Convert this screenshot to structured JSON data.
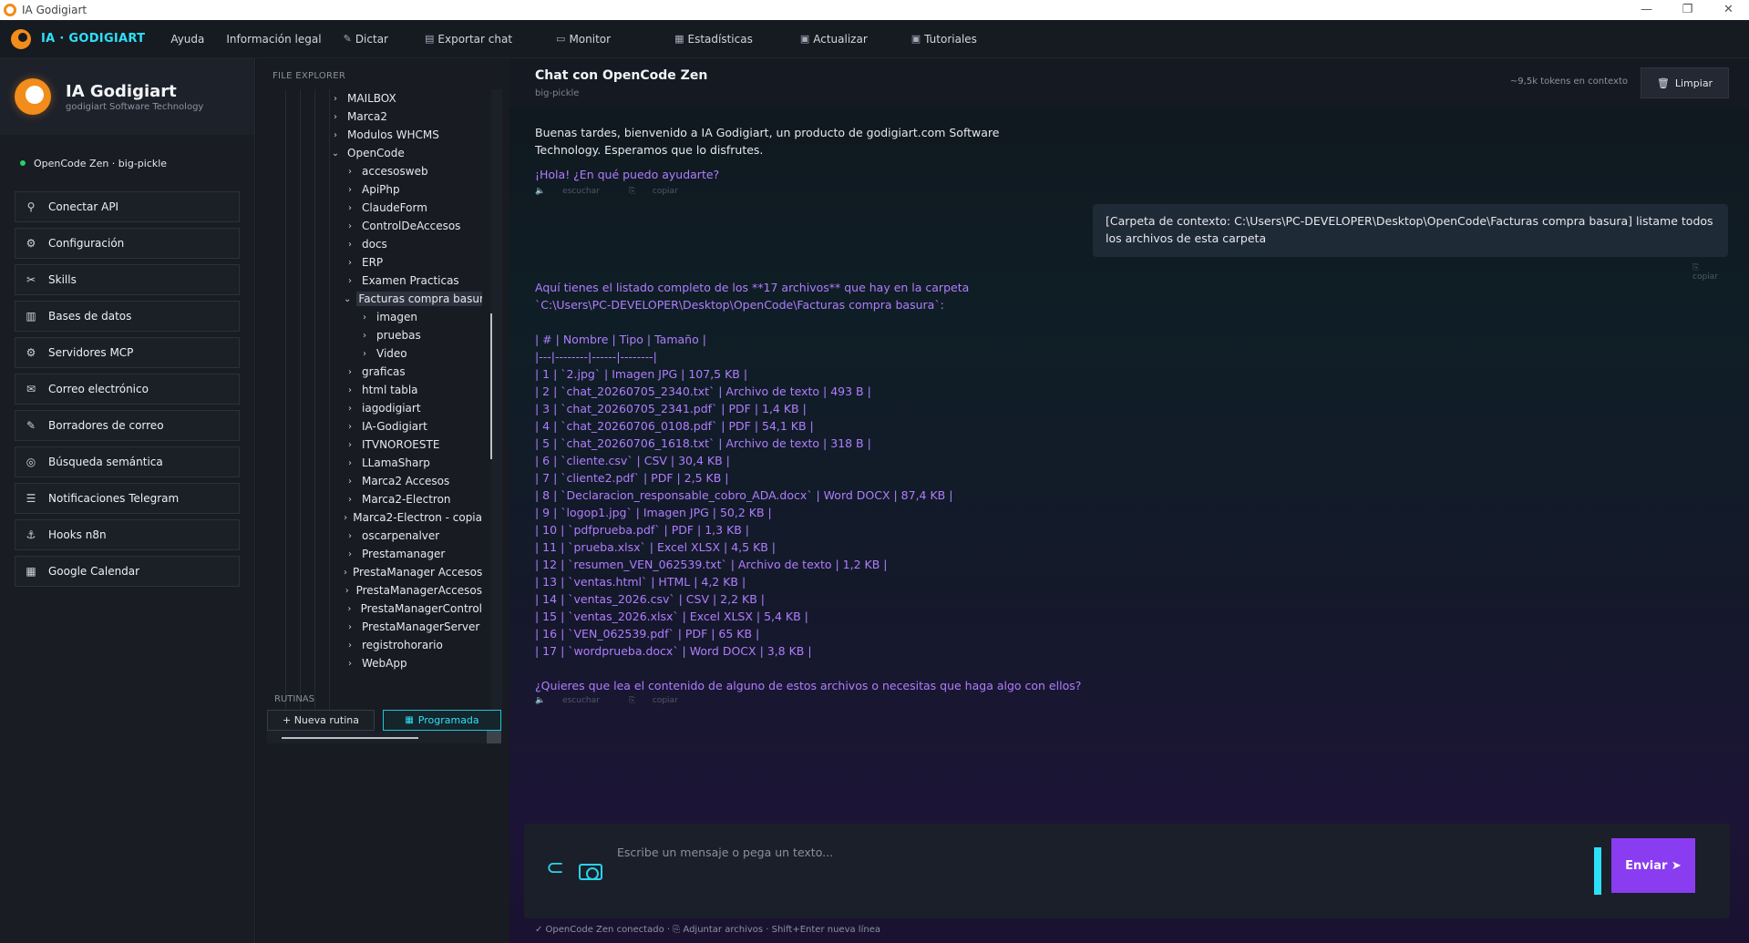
{
  "window": {
    "title": "IA Godigiart",
    "controls": [
      "—",
      "❐",
      "✕"
    ]
  },
  "menubar": {
    "brand": "IA · GODIGIART",
    "items": [
      {
        "label": "Ayuda",
        "icon": ""
      },
      {
        "label": "Información legal",
        "icon": ""
      },
      {
        "label": "Dictar",
        "icon": "✎"
      },
      {
        "label": "Exportar chat",
        "icon": "▤"
      },
      {
        "label": "Monitor",
        "icon": "▭"
      },
      {
        "label": "Estadísticas",
        "icon": "▦"
      },
      {
        "label": "Actualizar",
        "icon": "▣"
      },
      {
        "label": "Tutoriales",
        "icon": "▣"
      }
    ]
  },
  "sidebar": {
    "title": "IA Godigiart",
    "subtitle": "godigiart Software Technology",
    "status": "OpenCode Zen · big-pickle",
    "nav": [
      {
        "label": "Conectar API",
        "icon": "⚲"
      },
      {
        "label": "Configuración",
        "icon": "⚙"
      },
      {
        "label": "Skills",
        "icon": "✂"
      },
      {
        "label": "Bases de datos",
        "icon": "▥"
      },
      {
        "label": "Servidores MCP",
        "icon": "⚙"
      },
      {
        "label": "Correo electrónico",
        "icon": "✉"
      },
      {
        "label": "Borradores de correo",
        "icon": "✎"
      },
      {
        "label": "Búsqueda semántica",
        "icon": "◎"
      },
      {
        "label": "Notificaciones Telegram",
        "icon": "☰"
      },
      {
        "label": "Hooks n8n",
        "icon": "⚓"
      },
      {
        "label": "Google Calendar",
        "icon": "▦"
      }
    ]
  },
  "explorer": {
    "label": "FILE EXPLORER",
    "tree": [
      {
        "name": "MAILBOX",
        "depth": 0,
        "open": false
      },
      {
        "name": "Marca2",
        "depth": 0,
        "open": false
      },
      {
        "name": "Modulos WHCMS",
        "depth": 0,
        "open": false
      },
      {
        "name": "OpenCode",
        "depth": 0,
        "open": true
      },
      {
        "name": "accesosweb",
        "depth": 1,
        "open": false
      },
      {
        "name": "ApiPhp",
        "depth": 1,
        "open": false
      },
      {
        "name": "ClaudeForm",
        "depth": 1,
        "open": false
      },
      {
        "name": "ControlDeAccesos",
        "depth": 1,
        "open": false
      },
      {
        "name": "docs",
        "depth": 1,
        "open": false
      },
      {
        "name": "ERP",
        "depth": 1,
        "open": false
      },
      {
        "name": "Examen Practicas",
        "depth": 1,
        "open": false
      },
      {
        "name": "Facturas compra basura",
        "depth": 1,
        "open": true,
        "selected": true
      },
      {
        "name": "imagen",
        "depth": 2,
        "open": false
      },
      {
        "name": "pruebas",
        "depth": 2,
        "open": false
      },
      {
        "name": "Video",
        "depth": 2,
        "open": false
      },
      {
        "name": "graficas",
        "depth": 1,
        "open": false
      },
      {
        "name": "html tabla",
        "depth": 1,
        "open": false
      },
      {
        "name": "iagodigiart",
        "depth": 1,
        "open": false
      },
      {
        "name": "IA-Godigiart",
        "depth": 1,
        "open": false
      },
      {
        "name": "ITVNOROESTE",
        "depth": 1,
        "open": false
      },
      {
        "name": "LLamaSharp",
        "depth": 1,
        "open": false
      },
      {
        "name": "Marca2 Accesos",
        "depth": 1,
        "open": false
      },
      {
        "name": "Marca2-Electron",
        "depth": 1,
        "open": false
      },
      {
        "name": "Marca2-Electron - copia",
        "depth": 1,
        "open": false
      },
      {
        "name": "oscarpenalver",
        "depth": 1,
        "open": false
      },
      {
        "name": "Prestamanager",
        "depth": 1,
        "open": false
      },
      {
        "name": "PrestaManager Accesos",
        "depth": 1,
        "open": false
      },
      {
        "name": "PrestaManagerAccesos",
        "depth": 1,
        "open": false
      },
      {
        "name": "PrestaManagerControl",
        "depth": 1,
        "open": false
      },
      {
        "name": "PrestaManagerServer",
        "depth": 1,
        "open": false
      },
      {
        "name": "registrohorario",
        "depth": 1,
        "open": false
      },
      {
        "name": "WebApp",
        "depth": 1,
        "open": false
      }
    ],
    "rutinas_label": "RUTINAS",
    "new_routine": "+ Nueva rutina",
    "scheduled": "Programada"
  },
  "chat": {
    "title": "Chat con OpenCode Zen",
    "model": "big-pickle",
    "tokens": "~9,5k tokens en contexto",
    "clear": "Limpiar",
    "welcome": "Buenas tardes, bienvenido a IA Godigiart, un producto de godigiart.com Software Technology. Esperamos que lo disfrutes.",
    "greeting": "¡Hola! ¿En qué puedo ayudarte?",
    "listen": "escuchar",
    "copy": "copiar",
    "user_message": "[Carpeta de contexto: C:\\Users\\PC-DEVELOPER\\Desktop\\OpenCode\\Facturas compra basura] listame todos los archivos de esta carpeta",
    "reply_lines": [
      "Aquí tienes el listado completo de los **17 archivos** que hay en la carpeta",
      "`C:\\Users\\PC-DEVELOPER\\Desktop\\OpenCode\\Facturas compra basura`:",
      "",
      "| # | Nombre | Tipo | Tamaño |",
      "|---|--------|------|--------|",
      "| 1 | `2.jpg` | Imagen JPG | 107,5 KB |",
      "| 2 | `chat_20260705_2340.txt` | Archivo de texto | 493 B |",
      "| 3 | `chat_20260705_2341.pdf` | PDF | 1,4 KB |",
      "| 4 | `chat_20260706_0108.pdf` | PDF | 54,1 KB |",
      "| 5 | `chat_20260706_1618.txt` | Archivo de texto | 318 B |",
      "| 6 | `cliente.csv` | CSV | 30,4 KB |",
      "| 7 | `cliente2.pdf` | PDF | 2,5 KB |",
      "| 8 | `Declaracion_responsable_cobro_ADA.docx` | Word DOCX | 87,4 KB |",
      "| 9 | `logop1.jpg` | Imagen JPG | 50,2 KB |",
      "| 10 | `pdfprueba.pdf` | PDF | 1,3 KB |",
      "| 11 | `prueba.xlsx` | Excel XLSX | 4,5 KB |",
      "| 12 | `resumen_VEN_062539.txt` | Archivo de texto | 1,2 KB |",
      "| 13 | `ventas.html` | HTML | 4,2 KB |",
      "| 14 | `ventas_2026.csv` | CSV | 2,2 KB |",
      "| 15 | `ventas_2026.xlsx` | Excel XLSX | 5,4 KB |",
      "| 16 | `VEN_062539.pdf` | PDF | 65 KB |",
      "| 17 | `wordprueba.docx` | Word DOCX | 3,8 KB |",
      "",
      "¿Quieres que lea el contenido de alguno de estos archivos o necesitas que haga algo con ellos?"
    ],
    "input_placeholder": "Escribe un mensaje o pega un texto...",
    "send": "Enviar ➤",
    "footer": "✓ OpenCode Zen conectado · ⎘ Adjuntar archivos · Shift+Enter nueva línea"
  }
}
